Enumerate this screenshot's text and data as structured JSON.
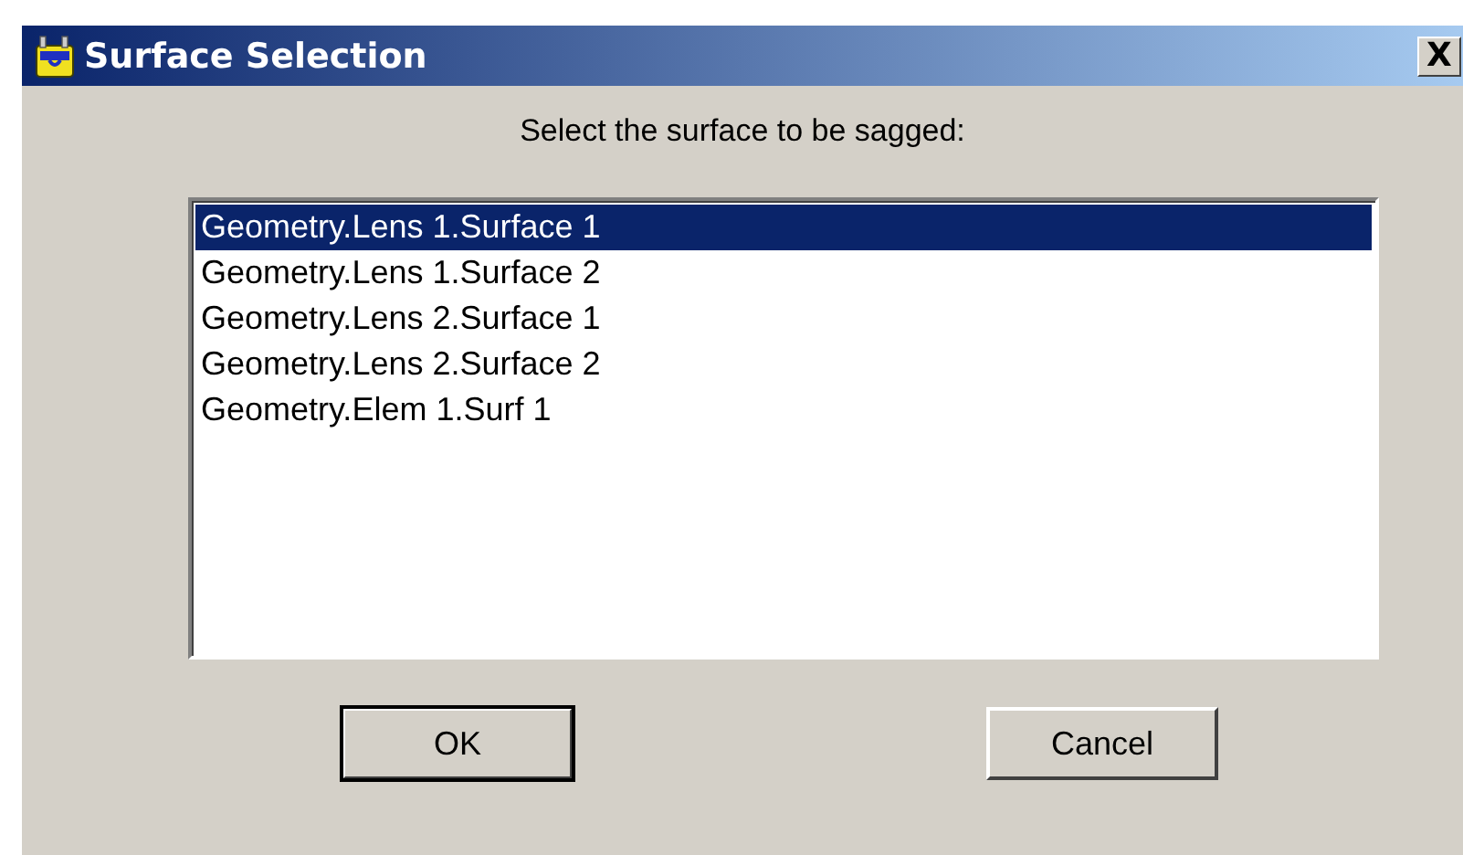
{
  "window": {
    "title": "Surface Selection",
    "close": "X"
  },
  "prompt": "Select the surface to be sagged:",
  "list": [
    {
      "label": "Geometry.Lens 1.Surface 1",
      "selected": true
    },
    {
      "label": "Geometry.Lens 1.Surface 2",
      "selected": false
    },
    {
      "label": "Geometry.Lens 2.Surface 1",
      "selected": false
    },
    {
      "label": "Geometry.Lens 2.Surface 2",
      "selected": false
    },
    {
      "label": "Geometry.Elem 1.Surf 1",
      "selected": false
    }
  ],
  "buttons": [
    {
      "label": "OK",
      "default": true
    },
    {
      "label": "Cancel",
      "default": false
    }
  ]
}
